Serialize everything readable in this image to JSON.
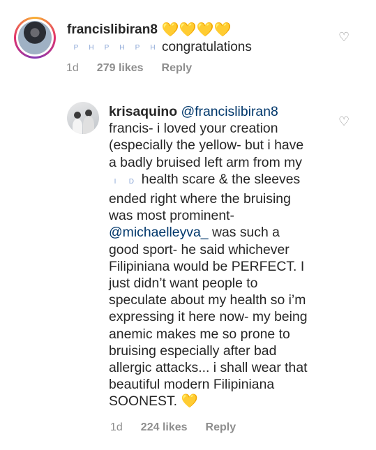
{
  "comments": [
    {
      "username": "francislibiran8",
      "emoji": "💛💛💛💛",
      "flags": [
        "P",
        "H",
        "P",
        "H",
        "P",
        "H"
      ],
      "text": "congratulations",
      "time": "1d",
      "likes": "279 likes",
      "reply": "Reply"
    },
    {
      "username": "krisaquino",
      "mention": "@francislibiran8",
      "lines": [
        "francis- i loved your creation",
        "(especially the yellow- but i have",
        "a badly bruised left arm from my",
        "health scare & the sleeves",
        "ended right where the bruising",
        "was most prominent-",
        "@michaelleyva_",
        " was such a",
        "good sport- he said whichever",
        "Filipiniana would be PERFECT. I",
        "just didn’t want people to",
        "speculate about my health so i’m",
        "expressing it here now- my being",
        "anemic makes me so prone to",
        "bruising especially after bad",
        "allergic attacks... i shall wear that",
        "beautiful modern Filipiniana",
        "SOONEST."
      ],
      "inline_flags": [
        "I",
        "D"
      ],
      "end_emoji": "💛",
      "time": "1d",
      "likes": "224 likes",
      "reply": "Reply"
    }
  ]
}
